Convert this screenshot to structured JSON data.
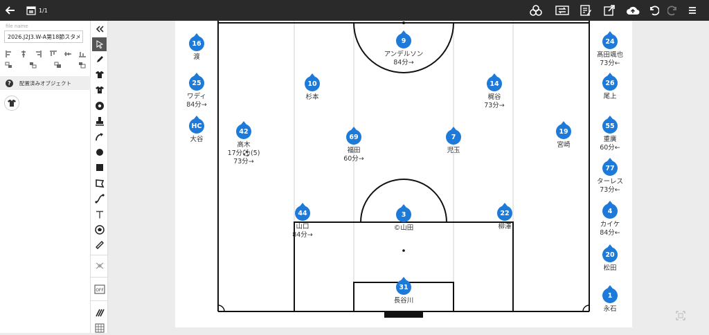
{
  "topbar": {
    "page_count": "1/1",
    "icons": [
      "back-arrow-icon",
      "pages-icon",
      "shapes-icon",
      "swap-icon",
      "edit-notes-icon",
      "share-icon",
      "cloud-upload-icon",
      "undo-icon",
      "redo-icon",
      "menu-icon"
    ]
  },
  "left_panel": {
    "file_label": "file name",
    "file_name": "2026.J2J3.W-A第18節スタメ",
    "placed_objects_label": "配置済みオブジェクト"
  },
  "tools": [
    "collapse-icon",
    "pointer-icon",
    "pen-icon",
    "shirt-icon",
    "shirt-dark-icon",
    "ball-icon",
    "stamp-icon",
    "curve-arrow-icon",
    "circle-icon",
    "square-icon",
    "polygon-icon",
    "line-icon",
    "text-icon",
    "ball-outline-icon",
    "ruler-icon",
    "formation-icon",
    "off-toggle-icon",
    "pattern-icon",
    "grid-icon"
  ],
  "players": [
    {
      "num": "9",
      "name": "アンデルソン",
      "note": "84分→",
      "note2": ""
    },
    {
      "num": "10",
      "name": "杉本",
      "note": "",
      "note2": ""
    },
    {
      "num": "14",
      "name": "梶谷",
      "note": "73分→",
      "note2": ""
    },
    {
      "num": "42",
      "name": "高木",
      "note": "17分⚽(5)",
      "note2": "73分→"
    },
    {
      "num": "69",
      "name": "福田",
      "note": "60分→",
      "note2": ""
    },
    {
      "num": "7",
      "name": "児玉",
      "note": "",
      "note2": ""
    },
    {
      "num": "19",
      "name": "宮崎",
      "note": "",
      "note2": ""
    },
    {
      "num": "44",
      "name": "山口",
      "note": "84分→",
      "note2": ""
    },
    {
      "num": "3",
      "name": "©山田",
      "note": "",
      "note2": ""
    },
    {
      "num": "22",
      "name": "柳澤",
      "note": "",
      "note2": ""
    },
    {
      "num": "31",
      "name": "長谷川",
      "note": "",
      "note2": ""
    }
  ],
  "bench_left": [
    {
      "num": "16",
      "name": "渡",
      "note": ""
    },
    {
      "num": "25",
      "name": "ワディ",
      "note": "84分→"
    },
    {
      "num": "HC",
      "name": "大谷",
      "note": ""
    }
  ],
  "bench_right": [
    {
      "num": "24",
      "name": "髙田颯也",
      "note": "73分←"
    },
    {
      "num": "26",
      "name": "尾上",
      "note": ""
    },
    {
      "num": "55",
      "name": "重廣",
      "note": "60分←"
    },
    {
      "num": "77",
      "name": "ターレス",
      "note": "73分←"
    },
    {
      "num": "4",
      "name": "カイケ",
      "note": "84分←"
    },
    {
      "num": "20",
      "name": "松田",
      "note": ""
    },
    {
      "num": "1",
      "name": "永石",
      "note": ""
    }
  ],
  "colors": {
    "player": "#1e7ad8",
    "topbar": "#2a2a2a",
    "active_tool": "#555555"
  }
}
